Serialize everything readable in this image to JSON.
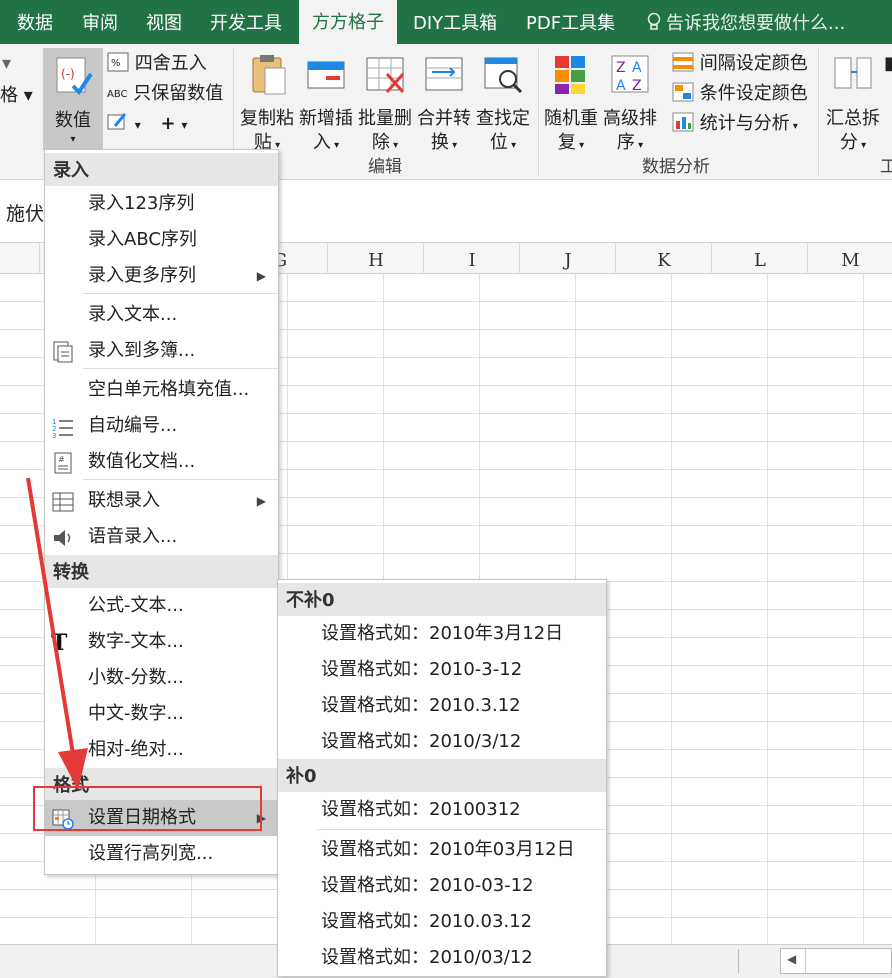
{
  "tabs": [
    {
      "label": "数据",
      "active": false
    },
    {
      "label": "审阅",
      "active": false
    },
    {
      "label": "视图",
      "active": false
    },
    {
      "label": "开发工具",
      "active": false
    },
    {
      "label": "方方格子",
      "active": true
    },
    {
      "label": "DIY工具箱",
      "active": false
    },
    {
      "label": "PDF工具集",
      "active": false
    }
  ],
  "tell_me": "告诉我您想要做什么...",
  "ribbon": {
    "left_cut_label": "格",
    "numeric_button": "数值",
    "round_label": "四舍五入",
    "keep_value_label": "只保留数值",
    "abc_icon_text": "ABC",
    "edit_buttons": [
      {
        "line1": "复制粘",
        "line2": "贴"
      },
      {
        "line1": "新增插",
        "line2": "入"
      },
      {
        "line1": "批量删",
        "line2": "除"
      },
      {
        "line1": "合并转",
        "line2": "换"
      },
      {
        "line1": "查找定",
        "line2": "位"
      }
    ],
    "edit_group_label": "编辑",
    "analysis_buttons": [
      {
        "line1": "随机重",
        "line2": "复"
      },
      {
        "line1": "高级排",
        "line2": "序"
      }
    ],
    "analysis_small": [
      "间隔设定颜色",
      "条件设定颜色",
      "统计与分析"
    ],
    "analysis_group_label": "数据分析",
    "summary_button": {
      "line1": "汇总拆",
      "line2": "分"
    },
    "right_cut_label": "工"
  },
  "formula_bar_text": "施伏",
  "columns": [
    "G",
    "H",
    "I",
    "J",
    "K",
    "L",
    "M"
  ],
  "menu": {
    "sections": [
      {
        "header": "录入",
        "items": [
          {
            "label": "录入123序列",
            "icon": "",
            "submenu": false
          },
          {
            "label": "录入ABC序列",
            "icon": "",
            "submenu": false
          },
          {
            "label": "录入更多序列",
            "icon": "",
            "submenu": true
          },
          {
            "label": "录入文本...",
            "icon": "",
            "submenu": false
          },
          {
            "label": "录入到多簿...",
            "icon": "multi-workbook-icon",
            "submenu": false
          },
          {
            "label": "空白单元格填充值...",
            "icon": "",
            "submenu": false
          },
          {
            "label": "自动编号...",
            "icon": "numbered-list-icon",
            "submenu": false
          },
          {
            "label": "数值化文档...",
            "icon": "numeric-doc-icon",
            "submenu": false
          },
          {
            "label": "联想录入",
            "icon": "suggest-input-icon",
            "submenu": true
          },
          {
            "label": "语音录入...",
            "icon": "speaker-icon",
            "submenu": false
          }
        ]
      },
      {
        "header": "转换",
        "items": [
          {
            "label": "公式-文本...",
            "icon": "",
            "submenu": false
          },
          {
            "label": "数字-文本...",
            "icon": "text-t-icon",
            "submenu": false
          },
          {
            "label": "小数-分数...",
            "icon": "",
            "submenu": false
          },
          {
            "label": "中文-数字...",
            "icon": "",
            "submenu": false
          },
          {
            "label": "相对-绝对...",
            "icon": "",
            "submenu": false
          }
        ]
      },
      {
        "header": "格式",
        "items": [
          {
            "label": "设置日期格式",
            "icon": "calendar-clock-icon",
            "submenu": true,
            "highlighted": true
          },
          {
            "label": "设置行高列宽...",
            "icon": "",
            "submenu": false
          }
        ]
      }
    ]
  },
  "submenu": {
    "sections": [
      {
        "header": "不补0",
        "items": [
          "设置格式如：2010年3月12日",
          "设置格式如：2010-3-12",
          "设置格式如：2010.3.12",
          "设置格式如：2010/3/12"
        ]
      },
      {
        "header": "补0",
        "items": [
          "设置格式如：20100312",
          "设置格式如：2010年03月12日",
          "设置格式如：2010-03-12",
          "设置格式如：2010.03.12",
          "设置格式如：2010/03/12"
        ]
      }
    ]
  },
  "colors": {
    "excel_green": "#217346",
    "annotation_red": "#e53935",
    "highlight": "#c9c9c9"
  }
}
